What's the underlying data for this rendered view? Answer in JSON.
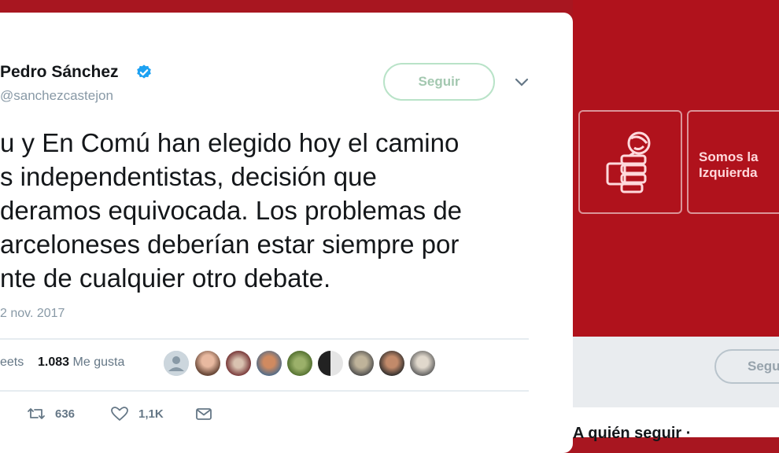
{
  "tweet": {
    "author_name": "Pedro Sánchez",
    "handle": "@sanchezcastejon",
    "follow_label": "Seguir",
    "text_lines": [
      "u y En Comú han elegido hoy el camino",
      "s independentistas, decisión que",
      "deramos equivocada. Los problemas de",
      "arceloneses deberían estar siempre por",
      "nte de cualquier otro debate."
    ],
    "date": "2 nov. 2017",
    "stats": {
      "retweets_label": "eets",
      "likes_count": "1.083",
      "likes_label": "Me gusta"
    },
    "actions": {
      "retweet_count": "636",
      "like_count": "1,1K"
    }
  },
  "background": {
    "tile_text": "Somos la\nIzquierda",
    "follow_label": "Segu",
    "who_to_follow": "A quién seguir ·"
  },
  "colors": {
    "background_red": "#a81620",
    "verified_blue": "#1da1f2",
    "follow_green": "#b9e3c8"
  },
  "icons": [
    "verified-badge-icon",
    "chevron-down-icon",
    "retweet-icon",
    "heart-icon",
    "envelope-icon",
    "psoe-rose-fist-icon"
  ]
}
